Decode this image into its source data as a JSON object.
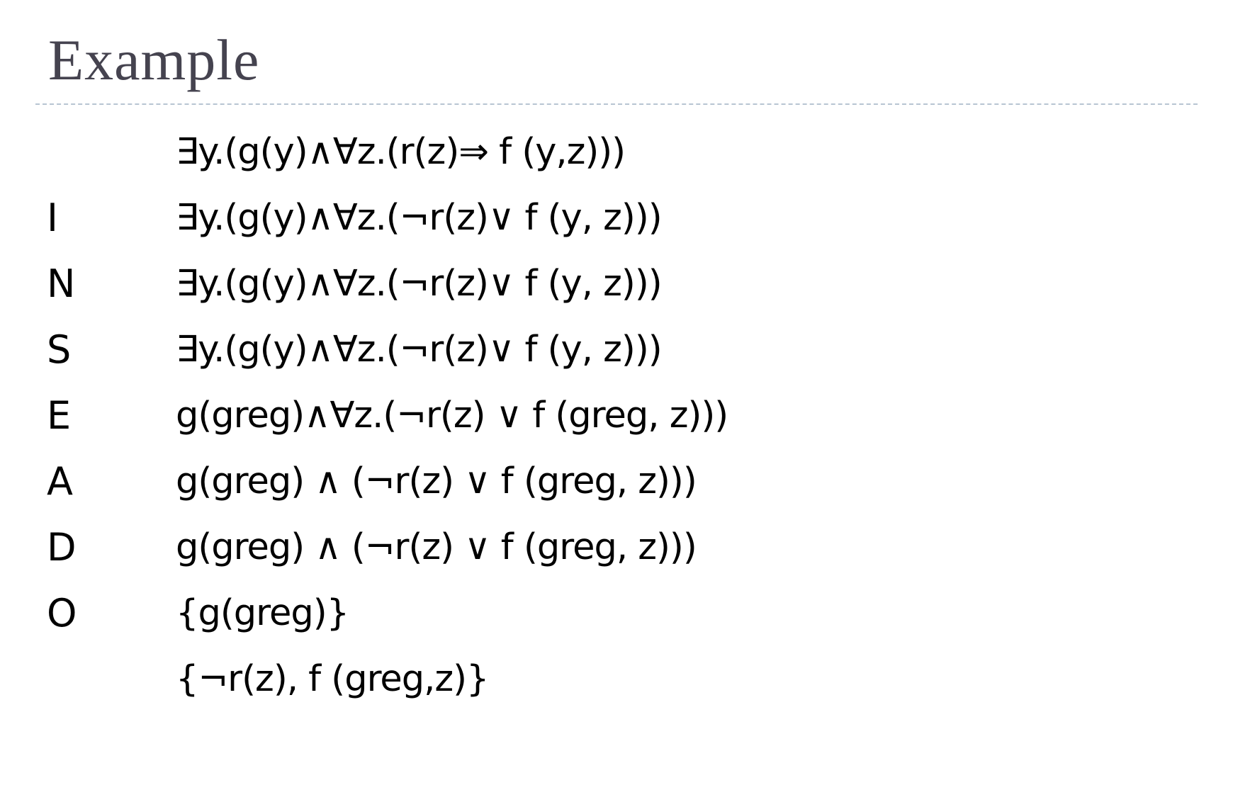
{
  "slide": {
    "title": "Example",
    "rows": [
      {
        "letter": "",
        "formula": "∃y.(g(y)∧∀z.(r(z)⇒ f (y,z)))"
      },
      {
        "letter": "I",
        "formula": "∃y.(g(y)∧∀z.(¬r(z)∨ f (y, z)))"
      },
      {
        "letter": "N",
        "formula": "∃y.(g(y)∧∀z.(¬r(z)∨ f (y, z)))"
      },
      {
        "letter": "S",
        "formula": "∃y.(g(y)∧∀z.(¬r(z)∨ f (y, z)))"
      },
      {
        "letter": "E",
        "formula": "g(greg)∧∀z.(¬r(z) ∨ f (greg, z)))"
      },
      {
        "letter": "A",
        "formula": "g(greg) ∧ (¬r(z) ∨ f (greg, z)))"
      },
      {
        "letter": "D",
        "formula": "g(greg) ∧ (¬r(z) ∨ f (greg, z)))"
      },
      {
        "letter": "O",
        "formula": "{g(greg)}"
      },
      {
        "letter": "",
        "formula": "{¬r(z), f (greg,z)}"
      }
    ]
  }
}
